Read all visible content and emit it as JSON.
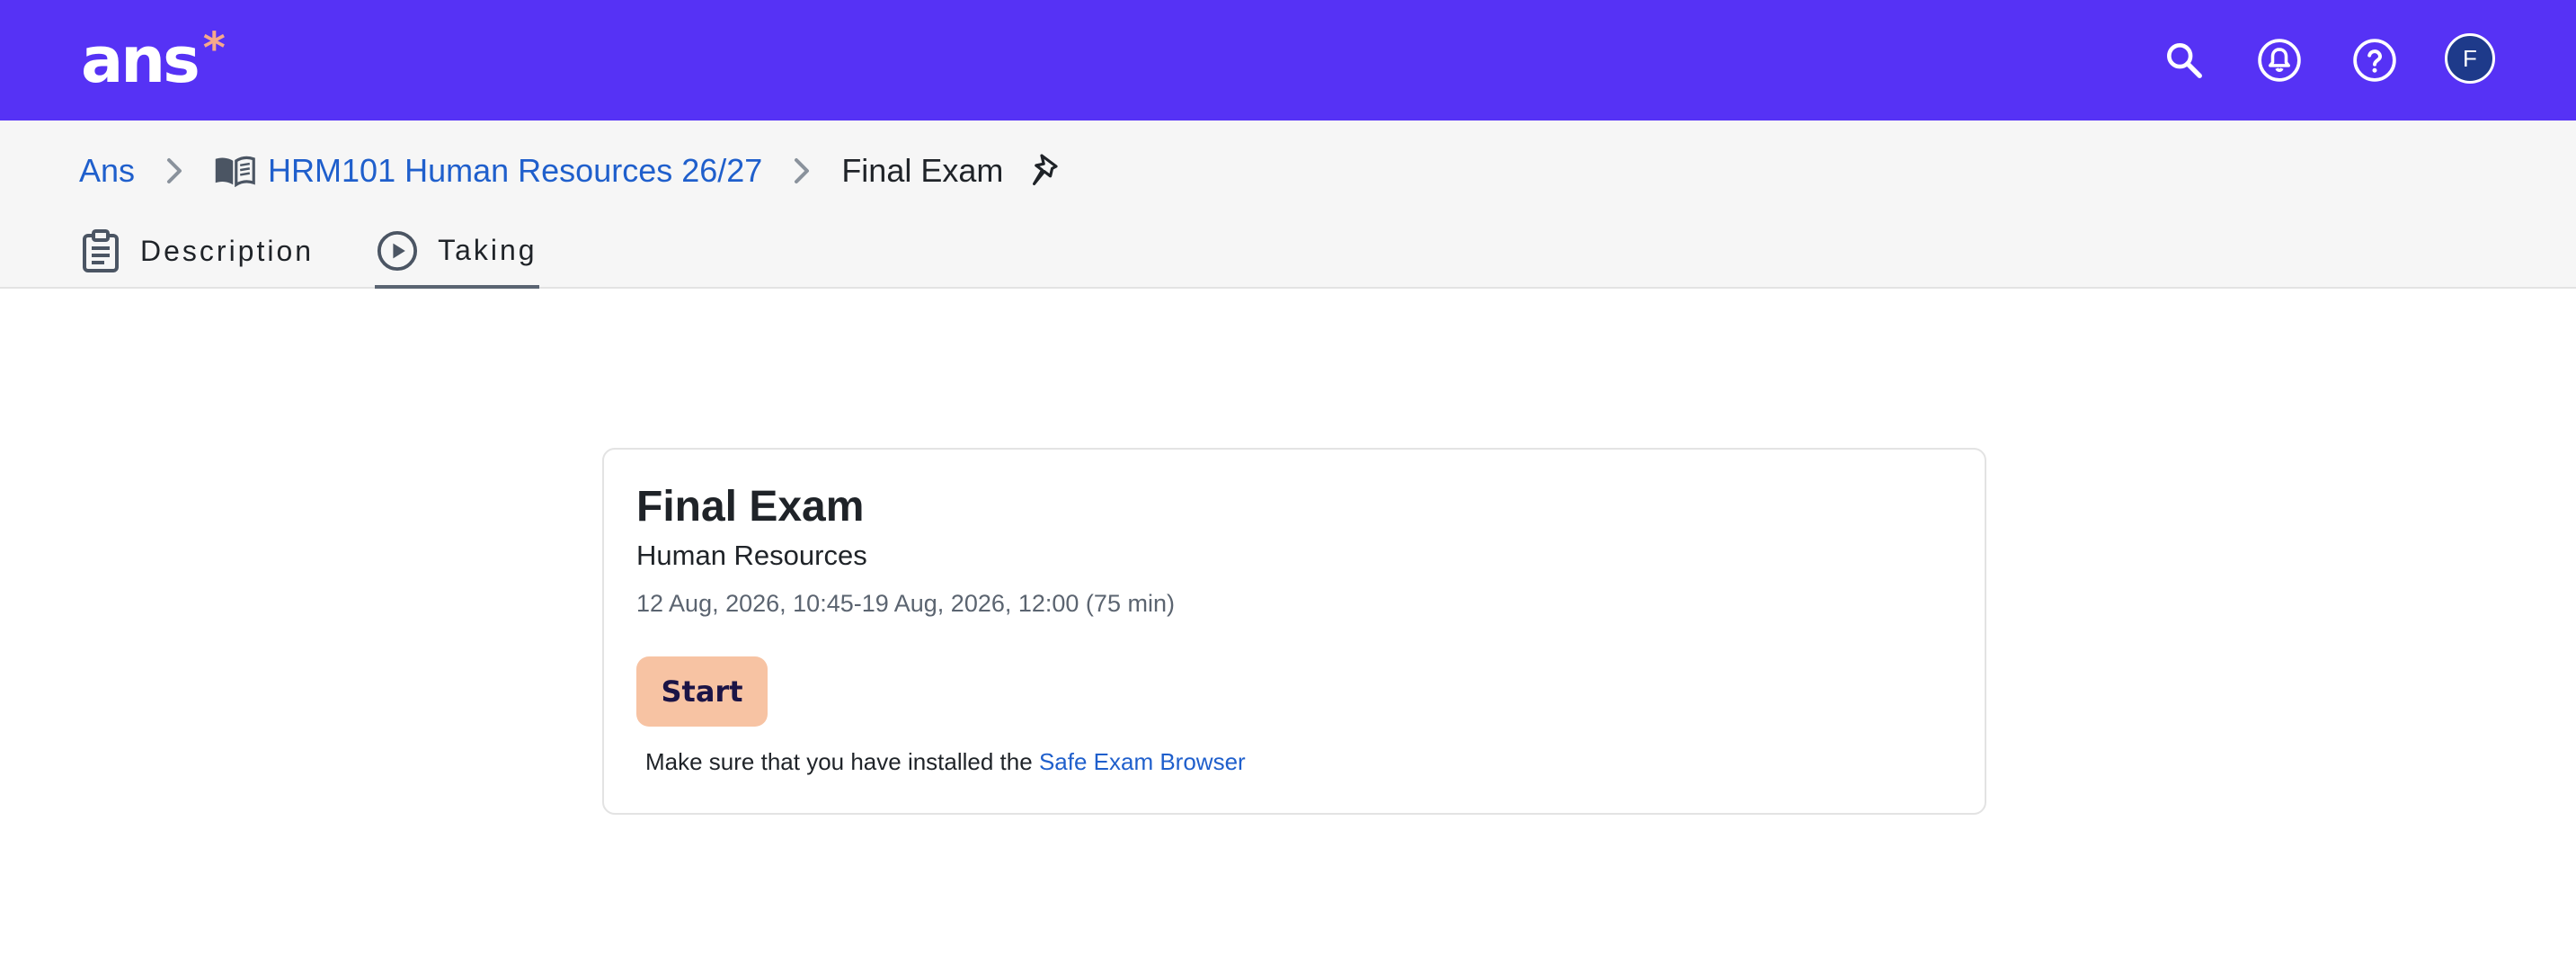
{
  "header": {
    "logo_text": "ans",
    "logo_mark": "*",
    "icons": [
      "search-icon",
      "bell-icon",
      "help-icon"
    ],
    "avatar_initial": "F",
    "colors": {
      "topbar": "#5632f5",
      "logo_accent": "#f7a98a",
      "avatar_bg": "#1e3a8a"
    }
  },
  "breadcrumb": {
    "root": "Ans",
    "course": "HRM101 Human Resources 26/27",
    "current": "Final Exam"
  },
  "tabs": [
    {
      "label": "Description",
      "icon": "clipboard-icon",
      "active": false
    },
    {
      "label": "Taking",
      "icon": "play-circle-icon",
      "active": true
    }
  ],
  "exam_card": {
    "title": "Final Exam",
    "subtitle": "Human Resources",
    "time_window": "12 Aug, 2026, 10:45-19 Aug, 2026, 12:00 (75 min)",
    "start_label": "Start",
    "note_prefix": "Make sure that you have installed the ",
    "note_link": "Safe Exam Browser",
    "colors": {
      "start_button": "#f7c3a3",
      "link": "#1f5fcc"
    }
  }
}
